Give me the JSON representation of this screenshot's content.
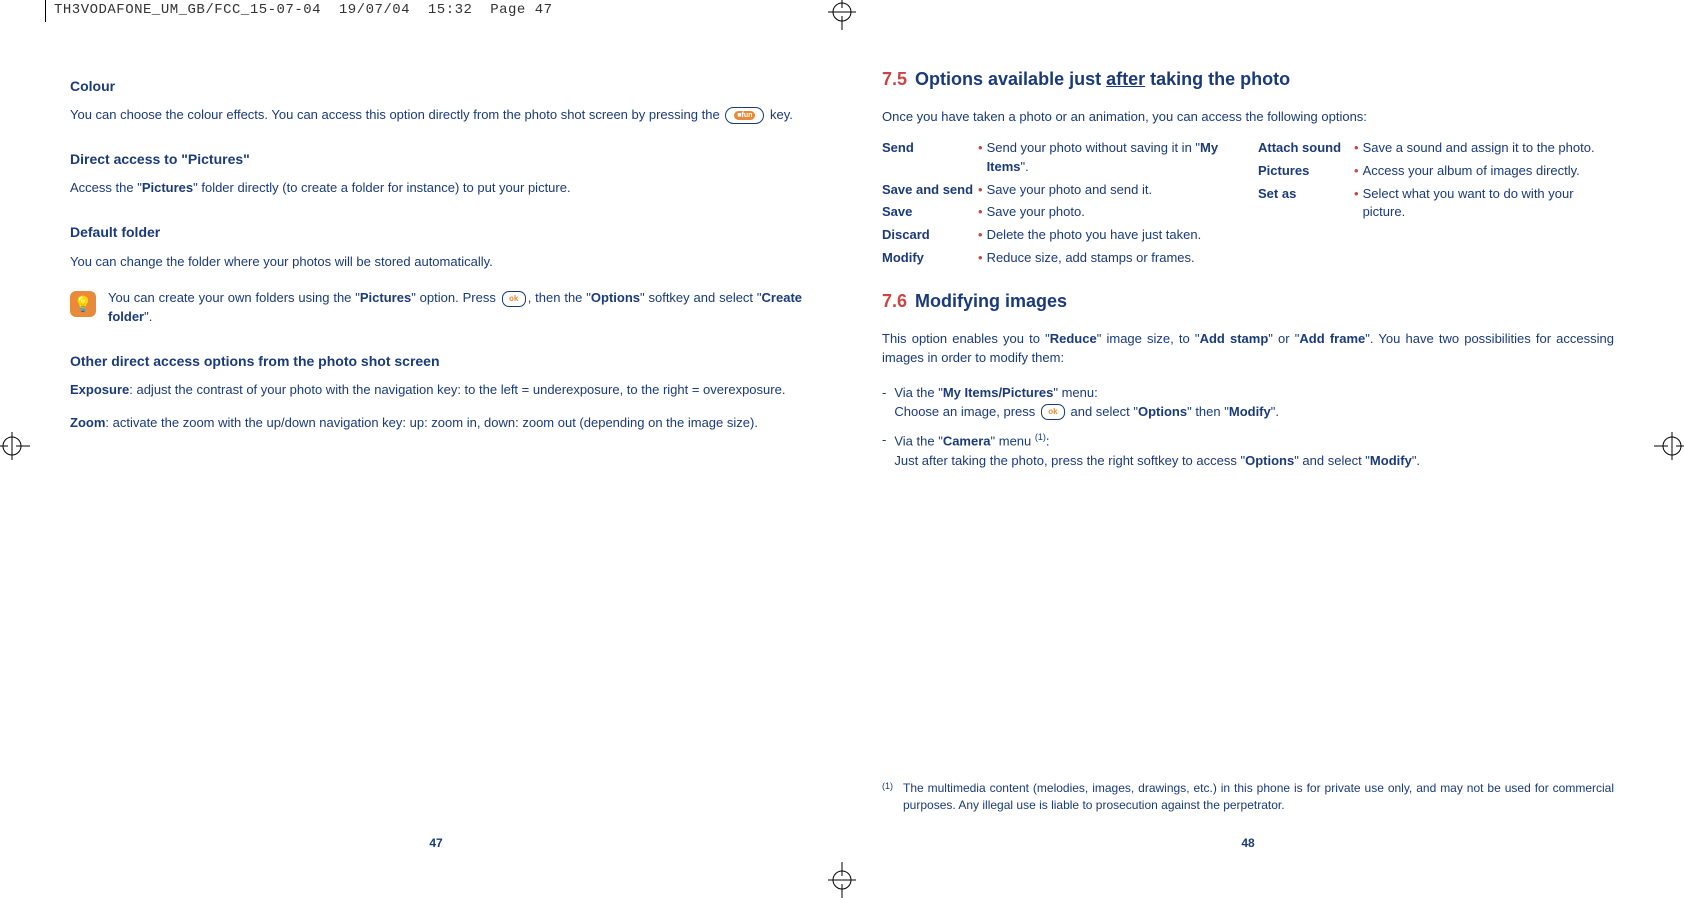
{
  "header": {
    "filename": "TH3VODAFONE_UM_GB/FCC_15-07-04",
    "date": "19/07/04",
    "time": "15:32",
    "page_label": "Page 47"
  },
  "left": {
    "h_colour": "Colour",
    "p_colour_a": "You can choose the colour effects. You can access this option directly from the photo shot screen by pressing the ",
    "p_colour_b": " key.",
    "h_direct": "Direct access to \"Pictures\"",
    "p_direct_a": "Access the \"",
    "p_direct_bold": "Pictures",
    "p_direct_b": "\" folder directly (to create a folder for instance) to put your picture.",
    "h_default": "Default folder",
    "p_default": "You can change the folder where your photos will be stored automatically.",
    "tip_a": "You can create your own folders using the \"",
    "tip_bold1": "Pictures",
    "tip_b": "\" option. Press ",
    "tip_c": ", then the \"",
    "tip_bold2": "Options",
    "tip_d": "\" softkey and select \"",
    "tip_bold3": "Create folder",
    "tip_e": "\".",
    "h_other": "Other direct access options from the photo shot screen",
    "exp_bold": "Exposure",
    "exp_text": ": adjust the contrast of your photo with the navigation key: to the left = underexposure, to the right = overexposure.",
    "zoom_bold": "Zoom",
    "zoom_text": ": activate the zoom with the up/down navigation key: up: zoom in, down: zoom out (depending on the image size).",
    "page_num": "47"
  },
  "right": {
    "sec75_num": "7.5",
    "sec75_a": "Options available just ",
    "sec75_under": "after",
    "sec75_b": " taking the photo",
    "p75_intro": "Once you have taken a photo or an animation, you can access the following options:",
    "opts_left": [
      {
        "label": "Send",
        "desc_a": "Send your photo without saving it in \"",
        "desc_bold": "My Items",
        "desc_b": "\"."
      },
      {
        "label": "Save and send",
        "desc_a": "Save your photo and send it.",
        "desc_bold": "",
        "desc_b": ""
      },
      {
        "label": "Save",
        "desc_a": "Save your photo.",
        "desc_bold": "",
        "desc_b": ""
      },
      {
        "label": "Discard",
        "desc_a": "Delete the photo you have just taken.",
        "desc_bold": "",
        "desc_b": ""
      },
      {
        "label": "Modify",
        "desc_a": "Reduce size, add stamps or frames.",
        "desc_bold": "",
        "desc_b": ""
      }
    ],
    "opts_right": [
      {
        "label": "Attach sound",
        "desc_a": "Save a sound and assign it to the photo.",
        "desc_bold": "",
        "desc_b": ""
      },
      {
        "label": "Pictures",
        "desc_a": "Access your album of images directly.",
        "desc_bold": "",
        "desc_b": ""
      },
      {
        "label": "Set as",
        "desc_a": "Select what you want to do with your picture.",
        "desc_bold": "",
        "desc_b": ""
      }
    ],
    "sec76_num": "7.6",
    "sec76_title": "Modifying images",
    "p76_a": "This option enables you to \"",
    "p76_bold1": "Reduce",
    "p76_b": "\" image size, to \"",
    "p76_bold2": "Add stamp",
    "p76_c": "\" or \"",
    "p76_bold3": "Add frame",
    "p76_d": "\". You have two possibilities for accessing images in order to modify them:",
    "m1_a": "Via the \"",
    "m1_bold": "My Items/Pictures",
    "m1_b": "\" menu:",
    "m1_line2_a": "Choose an image, press ",
    "m1_line2_b": " and select \"",
    "m1_line2_bold1": "Options",
    "m1_line2_c": "\" then \"",
    "m1_line2_bold2": "Modify",
    "m1_line2_d": "\".",
    "m2_a": "Via the \"",
    "m2_bold": "Camera",
    "m2_b": "\" menu ",
    "m2_sup": "(1)",
    "m2_c": ":",
    "m2_line2_a": "Just after taking the photo, press the right softkey to access \"",
    "m2_line2_bold1": "Options",
    "m2_line2_b": "\" and select \"",
    "m2_line2_bold2": "Modify",
    "m2_line2_c": "\".",
    "footnote_marker": "(1)",
    "footnote_body": "The multimedia content (melodies, images, drawings, etc.) in this phone is for private use only, and may not be used for commercial purposes. Any illegal use is liable to prosecution against the perpetrator.",
    "page_num": "48"
  },
  "key_labels": {
    "fun": "■fun",
    "ok": "ok"
  }
}
